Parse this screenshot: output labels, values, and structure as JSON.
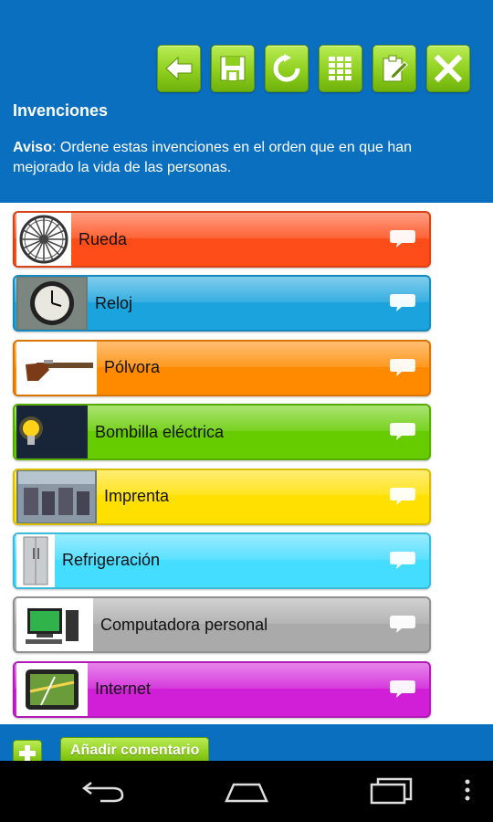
{
  "header": {
    "title": "Invenciones",
    "notice_label": "Aviso",
    "notice_text": ": Ordene estas invenciones en el orden que en que han mejorado la vida de las personas.",
    "background": "#0b6fc0",
    "toolbar": [
      {
        "name": "back-arrow-icon"
      },
      {
        "name": "save-icon"
      },
      {
        "name": "refresh-icon"
      },
      {
        "name": "list-icon"
      },
      {
        "name": "edit-clipboard-icon"
      },
      {
        "name": "close-icon"
      }
    ],
    "toolbar_color": "#8fcf1e"
  },
  "items": [
    {
      "label": "Rueda",
      "color": "#ff4d1a",
      "image": "wheel-image"
    },
    {
      "label": "Reloj",
      "color": "#1aa3dd",
      "image": "clock-image"
    },
    {
      "label": "Pólvora",
      "color": "#ff8a00",
      "image": "pistol-image"
    },
    {
      "label": "Bombilla eléctrica",
      "color": "#66cc00",
      "image": "light-bulb-image"
    },
    {
      "label": "Imprenta",
      "color": "#ffe000",
      "image": "printing-press-image"
    },
    {
      "label": "Refrigeración",
      "color": "#44dcff",
      "image": "refrigerator-image"
    },
    {
      "label": "Computadora personal",
      "color": "#aaaaaa",
      "image": "computer-image"
    },
    {
      "label": "Internet",
      "color": "#d11fd8",
      "image": "gps-device-image"
    }
  ],
  "footer": {
    "add_comment_label": "Añadir comentario"
  },
  "navbar": {
    "buttons": [
      "back-nav-icon",
      "home-nav-icon",
      "recent-apps-icon",
      "menu-dots-icon"
    ]
  }
}
